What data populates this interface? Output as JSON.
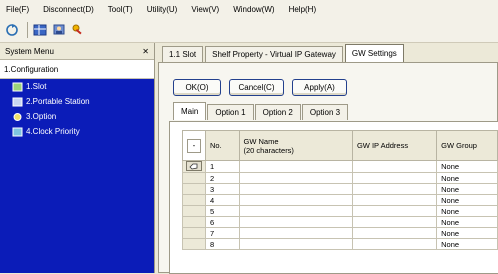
{
  "menubar": [
    "File(F)",
    "Disconnect(D)",
    "Tool(T)",
    "Utility(U)",
    "View(V)",
    "Window(W)",
    "Help(H)"
  ],
  "toolbar": {
    "icons": [
      "refresh-icon",
      "grid-icon",
      "user-icon",
      "key-icon"
    ]
  },
  "left_panel": {
    "title": "System Menu",
    "close_glyph": "✕",
    "section": "1.Configuration",
    "items": [
      {
        "label": "1.Slot",
        "icon": "slot-icon"
      },
      {
        "label": "2.Portable Station",
        "icon": "portable-station-icon"
      },
      {
        "label": "3.Option",
        "icon": "option-icon"
      },
      {
        "label": "4.Clock Priority",
        "icon": "clock-priority-icon"
      }
    ]
  },
  "tabs": [
    "1.1 Slot",
    "Shelf Property - Virtual IP Gateway",
    "GW Settings"
  ],
  "buttons": {
    "ok": "OK(O)",
    "cancel": "Cancel(C)",
    "apply": "Apply(A)"
  },
  "subtabs": [
    "Main",
    "Option 1",
    "Option 2",
    "Option 3"
  ],
  "grid": {
    "minus_label": "-",
    "columns": [
      "No.",
      "GW Name\n(20 characters)",
      "GW IP Address",
      "GW Group"
    ],
    "rows": [
      {
        "no": "1",
        "name": "",
        "ip": "",
        "group": "None"
      },
      {
        "no": "2",
        "name": "",
        "ip": "",
        "group": "None"
      },
      {
        "no": "3",
        "name": "",
        "ip": "",
        "group": "None"
      },
      {
        "no": "4",
        "name": "",
        "ip": "",
        "group": "None"
      },
      {
        "no": "5",
        "name": "",
        "ip": "",
        "group": "None"
      },
      {
        "no": "6",
        "name": "",
        "ip": "",
        "group": "None"
      },
      {
        "no": "7",
        "name": "",
        "ip": "",
        "group": "None"
      },
      {
        "no": "8",
        "name": "",
        "ip": "",
        "group": "None"
      }
    ]
  },
  "colors": {
    "left_list_bg": "#0b1cb8",
    "button_border": "#23408d"
  }
}
